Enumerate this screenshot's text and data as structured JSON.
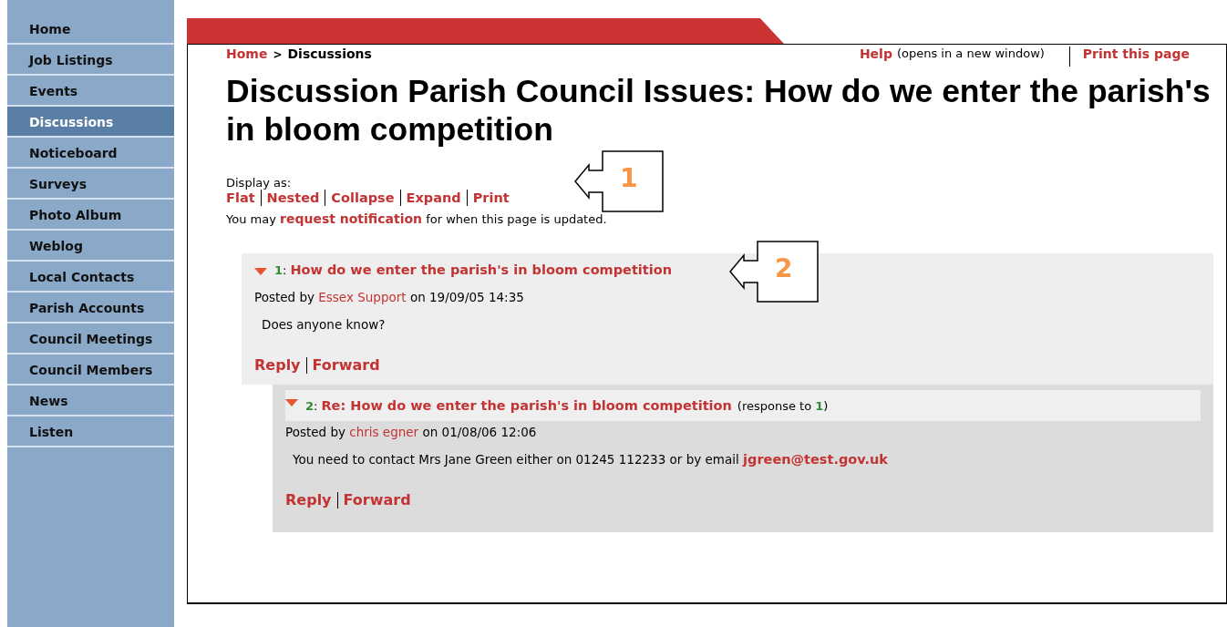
{
  "sidebar": {
    "items": [
      {
        "label": "Home",
        "selected": false
      },
      {
        "label": "Job Listings",
        "selected": false
      },
      {
        "label": "Events",
        "selected": false
      },
      {
        "label": "Discussions",
        "selected": true
      },
      {
        "label": "Noticeboard",
        "selected": false
      },
      {
        "label": "Surveys",
        "selected": false
      },
      {
        "label": "Photo Album",
        "selected": false
      },
      {
        "label": "Weblog",
        "selected": false
      },
      {
        "label": "Local Contacts",
        "selected": false
      },
      {
        "label": "Parish Accounts",
        "selected": false
      },
      {
        "label": "Council Meetings",
        "selected": false
      },
      {
        "label": "Council Members",
        "selected": false
      },
      {
        "label": "News",
        "selected": false
      },
      {
        "label": "Listen",
        "selected": false
      }
    ]
  },
  "breadcrumb": {
    "link": "Home",
    "separator": ">",
    "current": "Discussions"
  },
  "header_links": {
    "help": "Help",
    "help_note": "(opens in a new window)",
    "print": "Print this page"
  },
  "title": "Discussion Parish Council Issues: How do we enter the parish's in bloom competition",
  "display_as": {
    "label": "Display as:",
    "options": [
      "Flat",
      "Nested",
      "Collapse",
      "Expand",
      "Print"
    ]
  },
  "notification": {
    "prefix": "You may",
    "link": "request notification",
    "suffix": "for when this page is updated."
  },
  "posts": [
    {
      "number": "1",
      "number_separator": ":",
      "title": "How do we enter the parish's in bloom competition",
      "expanded": true,
      "posted_by": "Posted by",
      "author": "Essex Support",
      "date": "on 19/09/05 14:35",
      "body": "Does anyone know?",
      "actions": [
        "Reply",
        "Forward"
      ],
      "children": [
        {
          "number": "2",
          "number_separator": ":",
          "title": "Re: How do we enter the parish's in bloom competition",
          "expanded": true,
          "response_prefix": "(response to",
          "response_number": "1",
          "response_suffix": ")",
          "posted_by": "Posted by",
          "author": "chris egner",
          "date": "on 01/08/06 12:06",
          "body": "You need to contact Mrs Jane Green either on 01245 112233 or by email",
          "body_link": "jgreen@test.gov.uk",
          "actions": [
            "Reply",
            "Forward"
          ]
        }
      ]
    }
  ],
  "callouts": [
    {
      "label": "1"
    },
    {
      "label": "2"
    }
  ]
}
